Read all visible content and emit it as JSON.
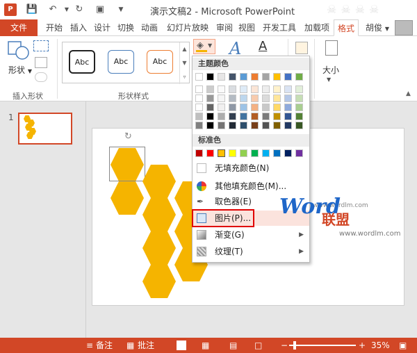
{
  "titlebar": {
    "title": "演示文稿2 - Microsoft PowerPoint",
    "app_logo": "P"
  },
  "tabs": [
    "文件",
    "开始",
    "插入",
    "设计",
    "切换",
    "动画",
    "幻灯片放映",
    "审阅",
    "视图",
    "开发工具",
    "加载项",
    "格式"
  ],
  "user": "胡俊",
  "ribbon": {
    "insert_shape_group": "插入形状",
    "shape_label": "形状",
    "style_group": "形状样式",
    "abc": [
      "Abc",
      "Abc",
      "Abc"
    ],
    "size_label": "大小"
  },
  "menu": {
    "theme_colors_header": "主题颜色",
    "standard_colors_header": "标准色",
    "items": [
      {
        "label": "无填充颜色(N)"
      },
      {
        "label": "其他填充颜色(M)..."
      },
      {
        "label": "取色器(E)"
      },
      {
        "label": "图片(P)..."
      },
      {
        "label": "渐变(G)"
      },
      {
        "label": "纹理(T)"
      }
    ]
  },
  "slides": {
    "number": "1"
  },
  "status": {
    "notes": "备注",
    "comments": "批注",
    "zoom": "35%"
  },
  "watermark": {
    "word": "Word",
    "cn": "联盟",
    "url": "www.wordlm.com",
    "url2": "www.wordlm.com"
  },
  "colors": {
    "accent": "#d24726",
    "hex_fill": "#f5b400"
  }
}
